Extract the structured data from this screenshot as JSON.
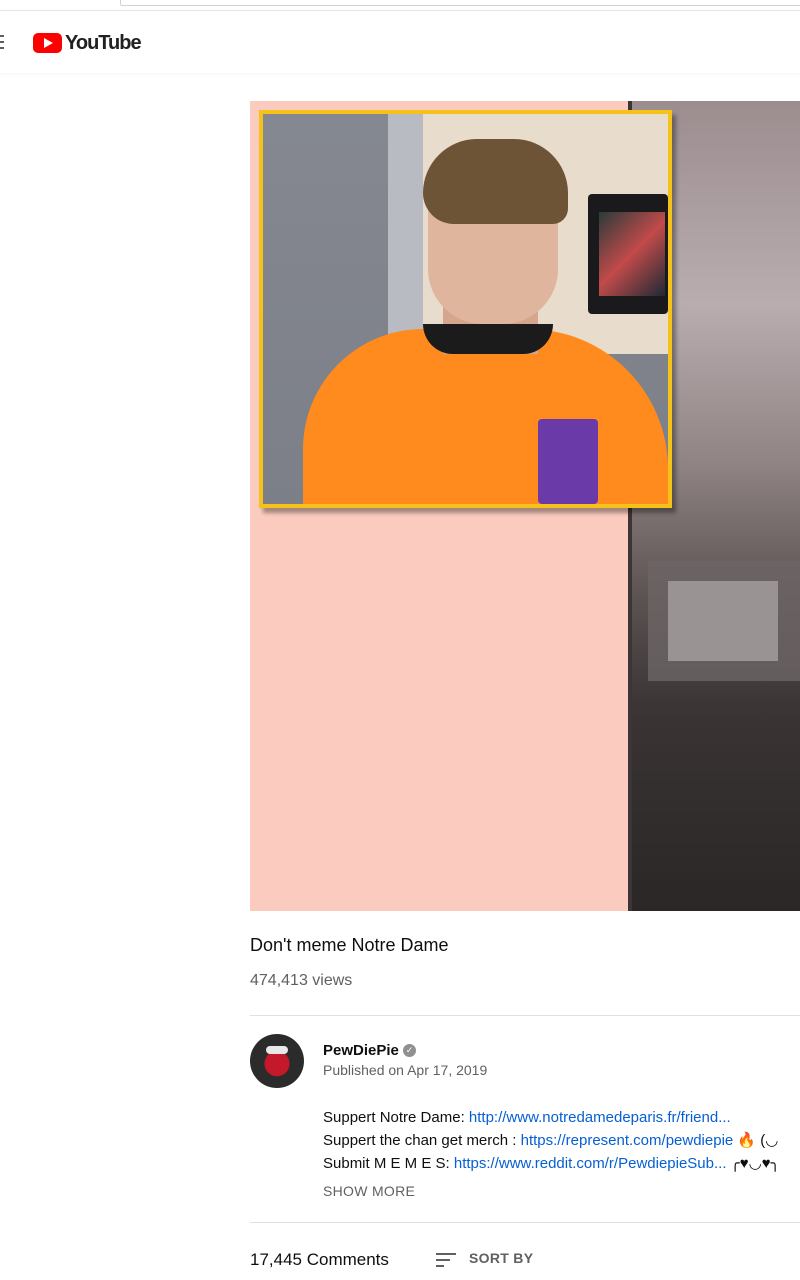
{
  "brand": {
    "logo_text": "YouTube",
    "accent": "#ff0000"
  },
  "video": {
    "title": "Don't meme Notre Dame",
    "views": "474,413 views"
  },
  "channel": {
    "name": "PewDiePie",
    "verified_icon": "check-circle-icon",
    "published": "Published on Apr 17, 2019"
  },
  "description": {
    "lines": [
      {
        "label": "Suppert Notre Dame: ",
        "link": "http://www.notredamedeparis.fr/friend...",
        "suffix": ""
      },
      {
        "label": "Suppert the chan get merch  : ",
        "link": "https://represent.com/pewdiepie",
        "suffix": " 🔥 (◡"
      },
      {
        "label": "Submit M E M E S: ",
        "link": "https://www.reddit.com/r/PewdiepieSub...",
        "suffix": " ╭♥◡♥╮"
      }
    ],
    "show_more": "SHOW MORE"
  },
  "comments": {
    "count": "17,445 Comments",
    "sort_label": "SORT BY"
  }
}
